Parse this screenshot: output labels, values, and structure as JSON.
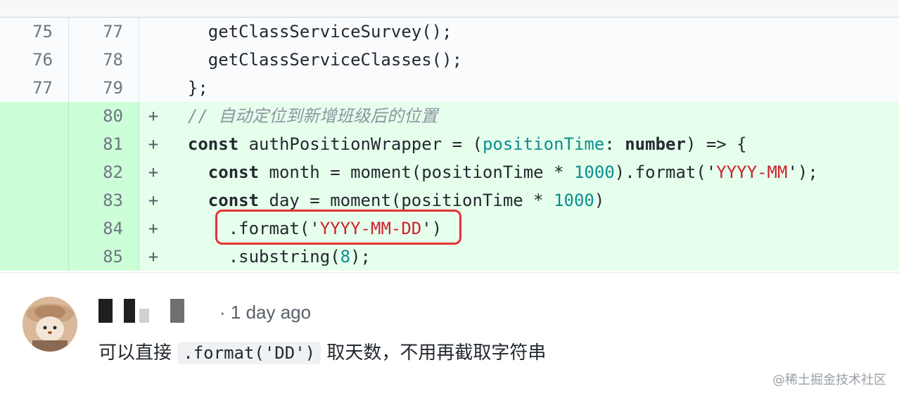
{
  "diff": {
    "lines": [
      {
        "old": "75",
        "new": "77",
        "sign": "",
        "type": "ctx"
      },
      {
        "old": "76",
        "new": "78",
        "sign": "",
        "type": "ctx"
      },
      {
        "old": "77",
        "new": "79",
        "sign": "",
        "type": "ctx"
      },
      {
        "old": "",
        "new": "80",
        "sign": "+",
        "type": "add"
      },
      {
        "old": "",
        "new": "81",
        "sign": "+",
        "type": "add"
      },
      {
        "old": "",
        "new": "82",
        "sign": "+",
        "type": "add"
      },
      {
        "old": "",
        "new": "83",
        "sign": "+",
        "type": "add"
      },
      {
        "old": "",
        "new": "84",
        "sign": "+",
        "type": "add"
      },
      {
        "old": "",
        "new": "85",
        "sign": "+",
        "type": "add"
      }
    ],
    "code": {
      "l1": "    getClassServiceSurvey();",
      "l2": "    getClassServiceClasses();",
      "l3": "  };",
      "l4_comment": "// 自动定位到新增班级后的位置",
      "l5_kw": "const",
      "l5_a": " authPositionWrapper = (",
      "l5_param": "positionTime",
      "l5_b": ": ",
      "l5_type": "number",
      "l5_c": ") => {",
      "l6_kw": "const",
      "l6_a": " month = moment(positionTime * ",
      "l6_num": "1000",
      "l6_b": ").format('",
      "l6_str": "YYYY-MM",
      "l6_c": "');",
      "l7_kw": "const",
      "l7_a": " day = moment(positionTime * ",
      "l7_num": "1000",
      "l7_b": ")",
      "l8_a": ".format('",
      "l8_str": "YYYY-MM-DD",
      "l8_b": "')",
      "l9_a": ".substring(",
      "l9_num": "8",
      "l9_b": ");"
    }
  },
  "comment": {
    "meta": "· 1 day ago",
    "text_before": "可以直接 ",
    "inline_code": ".format('DD')",
    "text_after": " 取天数，不用再截取字符串"
  },
  "watermark": "@稀土掘金技术社区",
  "colors": {
    "added_bg": "#e6ffec",
    "added_gutter": "#ccffd8",
    "highlight_border": "#e5322d",
    "string": "#cf222e",
    "number": "#0a8f8f"
  }
}
